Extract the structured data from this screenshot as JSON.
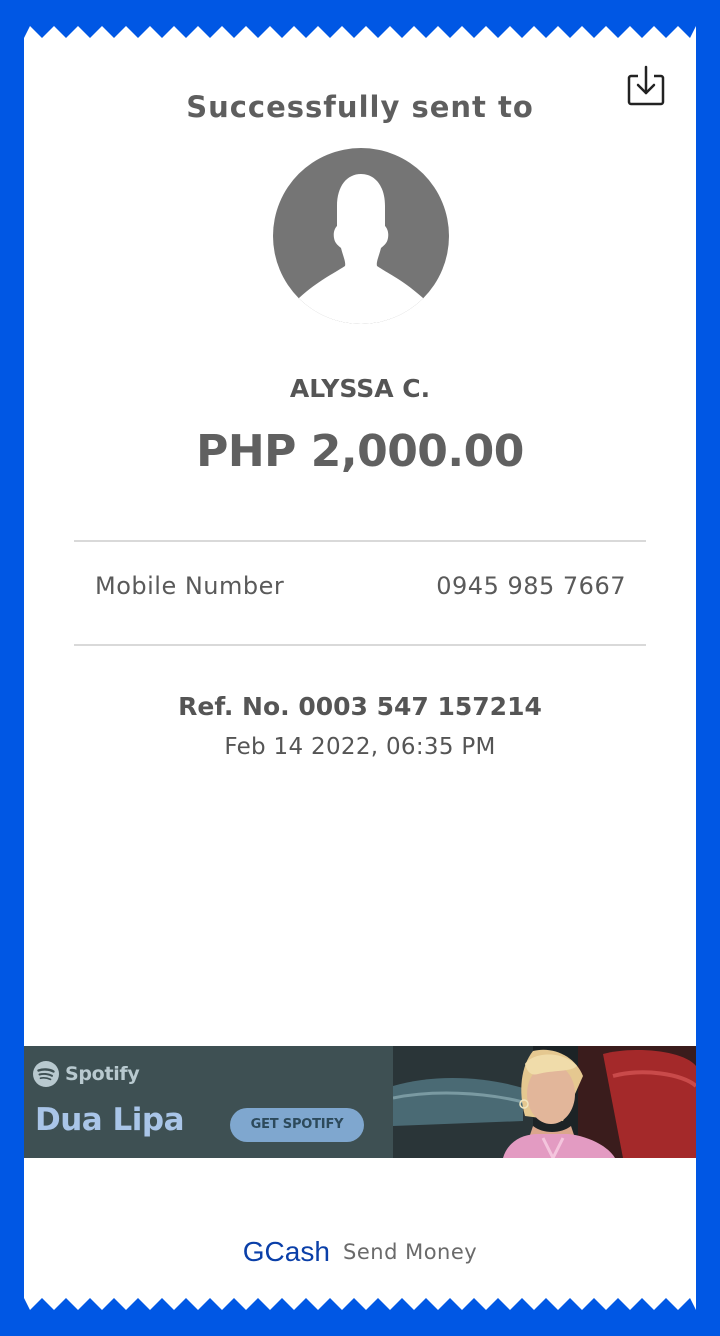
{
  "header": {
    "title": "Successfully sent to",
    "download_icon": "download-icon"
  },
  "recipient": {
    "avatar_icon": "avatar-placeholder-icon",
    "name": "ALYSSA C.",
    "amount": "PHP 2,000.00"
  },
  "details": {
    "mobile_label": "Mobile Number",
    "mobile_value": "0945 985 7667"
  },
  "reference": {
    "ref_no": "Ref. No. 0003 547 157214",
    "timestamp": "Feb 14 2022, 06:35 PM"
  },
  "ad": {
    "brand": "Spotify",
    "headline": "Dua Lipa",
    "cta": "GET SPOTIFY",
    "logo_icon": "spotify-logo-icon",
    "photo": "artist-photo"
  },
  "footer": {
    "brand": "GCash",
    "service": "Send Money"
  },
  "colors": {
    "background_blue": "#0057e4",
    "text_gray": "#5a5a5a",
    "gcash_blue": "#0a3fa8",
    "ad_background": "#3e5053",
    "ad_cta": "#7fa7cf"
  }
}
